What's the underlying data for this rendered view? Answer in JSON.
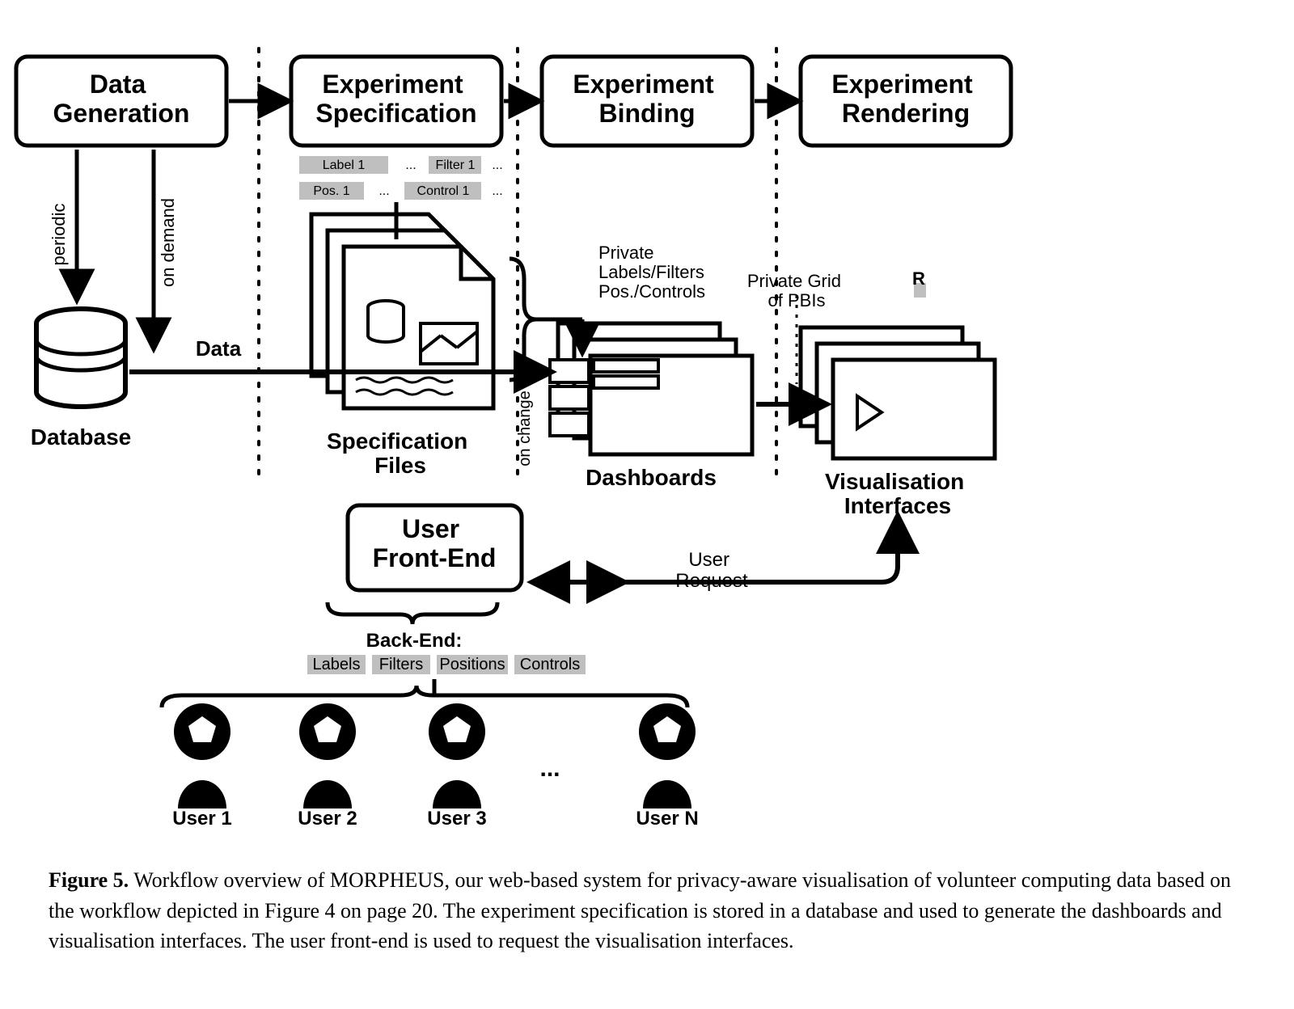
{
  "boxes": {
    "data_generation": "Data\nGeneration",
    "experiment_specification": "Experiment\nSpecification",
    "experiment_binding": "Experiment\nBinding",
    "experiment_rendering": "Experiment\nRendering",
    "user_frontend": "User\nFront-End"
  },
  "shape_labels": {
    "database_icon1": "Database",
    "spec_docs": "Specification\nFiles",
    "dashboards": "Dashboards",
    "visualisations": "Visualisation\nInterfaces"
  },
  "sublabels": {
    "top": [
      "Label 1",
      "...",
      "Filter 1",
      "..."
    ],
    "bottom": [
      "Pos. 1",
      "...",
      "Control 1",
      "..."
    ]
  },
  "users": [
    "User 1",
    "User 2",
    "User 3",
    "...",
    "User N"
  ],
  "arrow_labels": {
    "data_to_binding": "Data",
    "spec_to_binding": "Private\nLabels/Filters\nPos./Controls",
    "binding_to_render": "Private Grid\nof PBIs",
    "render_to_frontend": "User\nRequest",
    "backend_header": "Back-End:",
    "backend_sub": [
      "Labels",
      "Filters",
      "Positions",
      "Controls"
    ],
    "data_gen_arrows": [
      "periodic",
      "on demand"
    ],
    "spec_arrow": "on change"
  },
  "figure_caption": {
    "prefix": "Figure 5.",
    "body": "Workflow overview of MORPHEUS, our web-based system for privacy-aware visualisation of volunteer computing data based on the workflow depicted in Figure 4 on page 20. The experiment specification is stored in a database and used to generate the dashboards and visualisation interfaces. The user front-end is used to request the visualisation interfaces."
  }
}
